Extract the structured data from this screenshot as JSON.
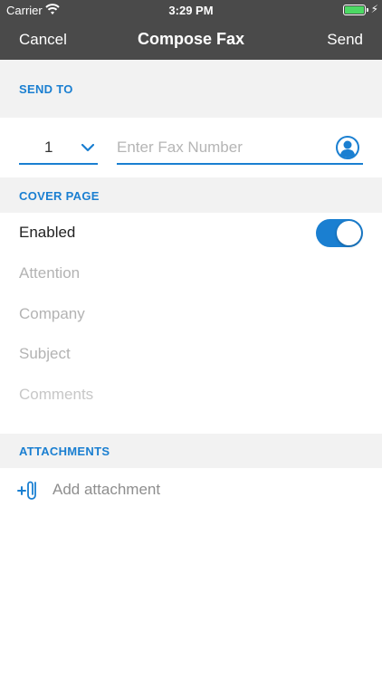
{
  "status_bar": {
    "carrier": "Carrier",
    "time": "3:29 PM"
  },
  "nav": {
    "cancel_label": "Cancel",
    "title": "Compose Fax",
    "send_label": "Send"
  },
  "send_to": {
    "header": "SEND TO",
    "country_code": "1",
    "fax_number_value": "",
    "fax_number_placeholder": "Enter Fax Number"
  },
  "cover_page": {
    "header": "COVER PAGE",
    "enabled_label": "Enabled",
    "enabled": true,
    "attention_placeholder": "Attention",
    "company_placeholder": "Company",
    "subject_placeholder": "Subject",
    "comments_placeholder": "Comments"
  },
  "attachments": {
    "header": "ATTACHMENTS",
    "add_label": "Add attachment"
  },
  "colors": {
    "accent": "#1a7fd1",
    "nav_bg": "#4a4a4a",
    "section_bg": "#f2f2f2",
    "battery": "#4cd964"
  },
  "icons": {
    "wifi": "wifi-icon",
    "battery": "battery-icon",
    "chevron": "chevron-down-icon",
    "contact": "contact-icon",
    "attach": "paperclip-plus-icon"
  }
}
